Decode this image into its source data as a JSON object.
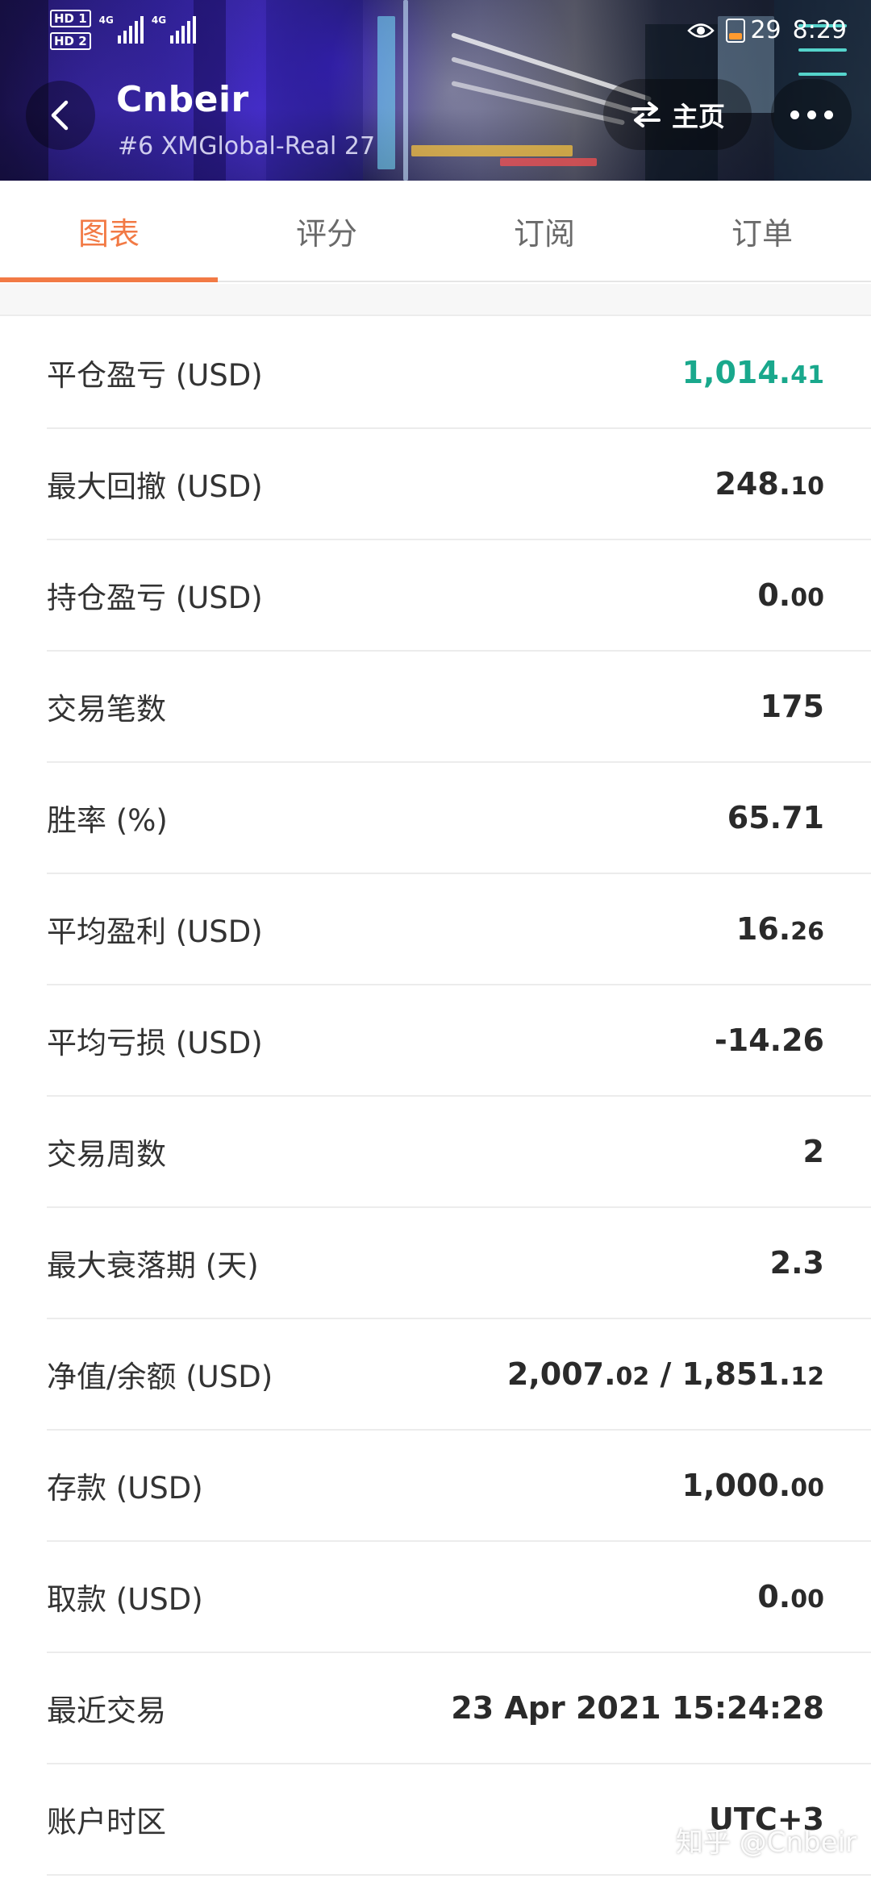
{
  "status_bar": {
    "hd1": "HD 1",
    "hd2": "HD 2",
    "net1": "4G",
    "net2": "4G",
    "battery": "29",
    "time": "8:29"
  },
  "header": {
    "account_name": "Cnbeir",
    "account_sub": "#6 XMGlobal-Real 27",
    "home_label": "主页"
  },
  "tabs": [
    {
      "label": "图表",
      "active": true
    },
    {
      "label": "评分",
      "active": false
    },
    {
      "label": "订阅",
      "active": false
    },
    {
      "label": "订单",
      "active": false
    }
  ],
  "stats": [
    {
      "label": "平仓盈亏 (USD)",
      "int": "1,014.",
      "dec": "41",
      "positive": true
    },
    {
      "label": "最大回撤 (USD)",
      "int": "248.",
      "dec": "10"
    },
    {
      "label": "持仓盈亏 (USD)",
      "int": "0.",
      "dec": "00"
    },
    {
      "label": "交易笔数",
      "int": "175",
      "dec": ""
    },
    {
      "label": "胜率 (%)",
      "int": "65.71",
      "dec": ""
    },
    {
      "label": "平均盈利 (USD)",
      "int": "16.",
      "dec": "26"
    },
    {
      "label": "平均亏损 (USD)",
      "int": "-14.26",
      "dec": ""
    },
    {
      "label": "交易周数",
      "int": "2",
      "dec": ""
    },
    {
      "label": "最大衰落期 (天)",
      "int": "2.3",
      "dec": ""
    },
    {
      "label": "净值/余额 (USD)",
      "int": "2,007.",
      "dec": "02",
      "int2": " / 1,851.",
      "dec2": "12"
    },
    {
      "label": "存款 (USD)",
      "int": "1,000.",
      "dec": "00"
    },
    {
      "label": "取款 (USD)",
      "int": "0.",
      "dec": "00"
    },
    {
      "label": "最近交易",
      "int": "23 Apr 2021 15:24:28",
      "dec": ""
    },
    {
      "label": "账户时区",
      "int": "UTC+3",
      "dec": ""
    }
  ],
  "watermark": "知乎 @Cnbeir",
  "colors": {
    "accent": "#f27a45",
    "positive": "#19a88c"
  }
}
